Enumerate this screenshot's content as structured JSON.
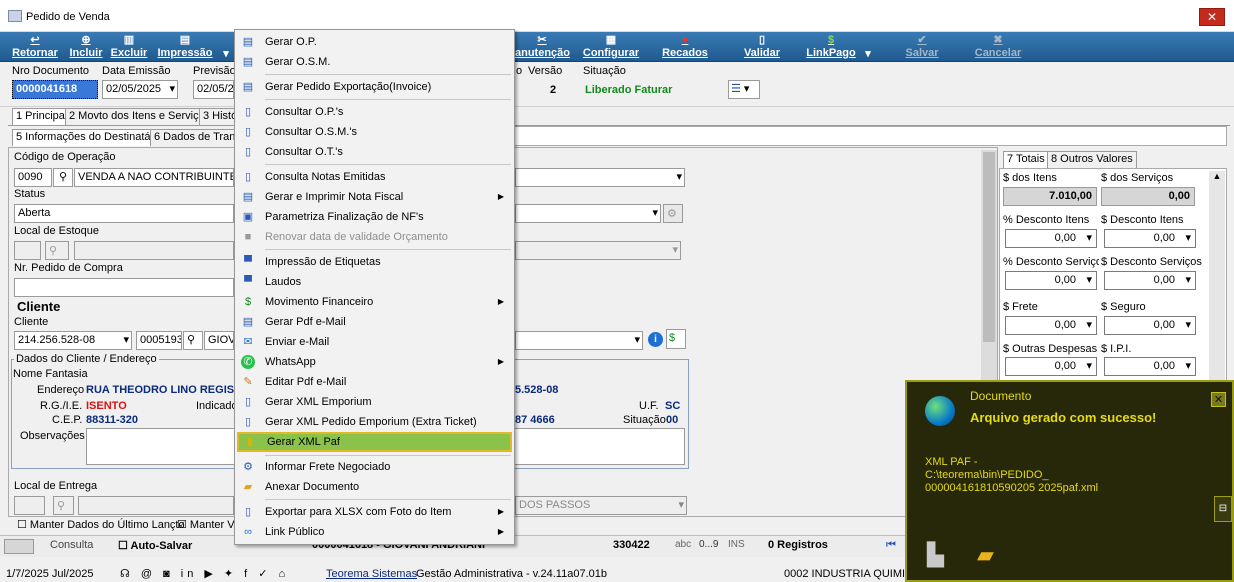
{
  "window": {
    "title": "Pedido de Venda",
    "close_glyph": "✕"
  },
  "toolbar": {
    "items": [
      {
        "label": "Retornar",
        "icon": "back-arrow-icon"
      },
      {
        "label": "Incluir",
        "icon": "plus-icon"
      },
      {
        "label": "Excluir",
        "icon": "trash-icon"
      },
      {
        "label": "Impressão",
        "icon": "printer-icon"
      },
      {
        "label": "anutenção",
        "icon": "tools-icon"
      },
      {
        "label": "Configurar",
        "icon": "config-icon"
      },
      {
        "label": "Recados",
        "icon": "note-icon"
      },
      {
        "label": "Validar",
        "icon": "validate-icon"
      },
      {
        "label": "LinkPago",
        "icon": "link-pago-icon"
      },
      {
        "label": "Salvar",
        "icon": "check-icon"
      },
      {
        "label": "Cancelar",
        "icon": "x-icon"
      }
    ]
  },
  "header": {
    "nro_label": "Nro Documento",
    "nro_value": "0000041618",
    "data_label": "Data Emissão",
    "data_value": "02/05/2025",
    "prev_label": "Previsão",
    "prev_value": "02/05/20",
    "o_label": "o",
    "versao_label": "Versão",
    "versao_value": "2",
    "situacao_label": "Situação",
    "situacao_value": "Liberado Faturar"
  },
  "tabs_top": [
    "1 Principal",
    "2 Movto dos Itens e Serviços",
    "3 Histó"
  ],
  "tabs_sub": [
    "5 Informações do Destinatário",
    "6 Dados de Transp"
  ],
  "form": {
    "codop_label": "Código de Operação",
    "codop_code": "0090",
    "codop_desc": "VENDA A NAO CONTRIBUINTE (",
    "status_label": "Status",
    "status_value": "Aberta",
    "local_estoque_label": "Local de Estoque",
    "nr_pedido_label": "Nr. Pedido de Compra",
    "cliente_header": "Cliente",
    "cliente_label": "Cliente",
    "cliente_doc": "214.256.528-08",
    "cliente_cod": "0005193",
    "cliente_nome": "GIOVA",
    "dados_group": "Dados do Cliente / Endereço",
    "nome_fantasia_label": "Nome Fantasia",
    "endereco_label": "Endereço",
    "endereco_value": "RUA THEODRO LINO REGIS",
    "doc_tail": "5.528-08",
    "rg_label": "R.G./I.E.",
    "rg_value": "ISENTO",
    "indicado_label": "Indicado",
    "uf_label": "U.F.",
    "uf_value": "SC",
    "cep_label": "C.E.P.",
    "cep_value": "88311-320",
    "fone_tail": "87 4666",
    "situacao_label": "Situação",
    "situacao_value": "00",
    "obs_label": "Observações",
    "local_entrega_label": "Local de Entrega",
    "local_entrega_tail": "DOS PASSOS",
    "chk_manter_dados": "Manter Dados do Último Lançto",
    "chk_manter_ve": "Manter Ve"
  },
  "totals": {
    "tabs": [
      "7 Totais",
      "8 Outros Valores"
    ],
    "itens_label": "$ dos Itens",
    "itens_value": "7.010,00",
    "servicos_label": "$ dos Serviços",
    "servicos_value": "0,00",
    "desc_itens_pct_label": "% Desconto Itens",
    "desc_itens_pct": "0,00",
    "desc_itens_val_label": "$ Desconto Itens",
    "desc_itens_val": "0,00",
    "desc_serv_pct_label": "% Desconto Serviço:",
    "desc_serv_pct": "0,00",
    "desc_serv_val_label": "$ Desconto Serviços",
    "desc_serv_val": "0,00",
    "frete_label": "$ Frete",
    "frete_value": "0,00",
    "seguro_label": "$ Seguro",
    "seguro_value": "0,00",
    "outras_label": "$ Outras Despesas",
    "outras_value": "0,00",
    "ipi_label": "$ I.P.I.",
    "ipi_value": "0,00"
  },
  "statusbar": {
    "consulta": "Consulta",
    "auto_salvar": "Auto-Salvar",
    "cliente_info": "0000041618 - GIOVANI ANDRIANI",
    "number": "330422",
    "abc": "abc",
    "range": "0...9",
    "ins": "INS",
    "registros": "0 Registros"
  },
  "footer": {
    "date": "1/7/2025 Jul/2025",
    "company": "Teorema Sistemas",
    "version": "Gestão Administrativa - v.24.11a07.01b",
    "empresa": "0002 INDUSTRIA QUIMI"
  },
  "menu": {
    "items": [
      {
        "label": "Gerar O.P.",
        "icon": "doc-gear-icon"
      },
      {
        "label": "Gerar O.S.M.",
        "icon": "doc-gear-icon"
      },
      {
        "label": "Gerar Pedido Exportação(Invoice)",
        "icon": "doc-gear-icon"
      },
      {
        "label": "Consultar O.P.'s",
        "icon": "doc-search-icon"
      },
      {
        "label": "Consultar O.S.M.'s",
        "icon": "doc-search-icon"
      },
      {
        "label": "Consultar O.T.'s",
        "icon": "doc-search-icon"
      },
      {
        "label": "Consulta Notas Emitidas",
        "icon": "doc-search-icon"
      },
      {
        "label": "Gerar e Imprimir Nota Fiscal",
        "icon": "doc-gear-icon",
        "submenu": true
      },
      {
        "label": "Parametriza Finalização de NF's",
        "icon": "settings-doc-icon"
      },
      {
        "label": "Renovar data de validade Orçamento",
        "icon": "calendar-icon",
        "disabled": true
      },
      {
        "label": "Impressão de Etiquetas",
        "icon": "printer-icon"
      },
      {
        "label": "Laudos",
        "icon": "printer-icon"
      },
      {
        "label": "Movimento Financeiro",
        "icon": "money-icon",
        "submenu": true
      },
      {
        "label": "Gerar Pdf e-Mail",
        "icon": "doc-gear-icon"
      },
      {
        "label": "Enviar e-Mail",
        "icon": "envelope-icon"
      },
      {
        "label": "WhatsApp",
        "icon": "whatsapp-icon",
        "submenu": true
      },
      {
        "label": "Editar Pdf e-Mail",
        "icon": "edit-icon"
      },
      {
        "label": "Gerar XML Emporium",
        "icon": "doc-search-icon"
      },
      {
        "label": "Gerar XML Pedido Emporium (Extra Ticket)",
        "icon": "doc-search-icon"
      },
      {
        "label": "Gerar XML Paf",
        "icon": "doc-yellow-icon",
        "highlighted": true
      },
      {
        "label": "Informar Frete Negociado",
        "icon": "gear-icon"
      },
      {
        "label": "Anexar Documento",
        "icon": "folder-icon"
      },
      {
        "label": "Exportar para XLSX com Foto do Item",
        "icon": "doc-search-icon",
        "submenu": true
      },
      {
        "label": "Link Público",
        "icon": "link-icon",
        "submenu": true
      }
    ]
  },
  "toast": {
    "title": "Documento",
    "message": "Arquivo gerado com sucesso!",
    "body_line1": "XML PAF -",
    "body_line2": "C:\\teorema\\bin\\PEDIDO_",
    "body_line3": "000004161810590205 2025paf.xml",
    "close_glyph": "✕"
  }
}
